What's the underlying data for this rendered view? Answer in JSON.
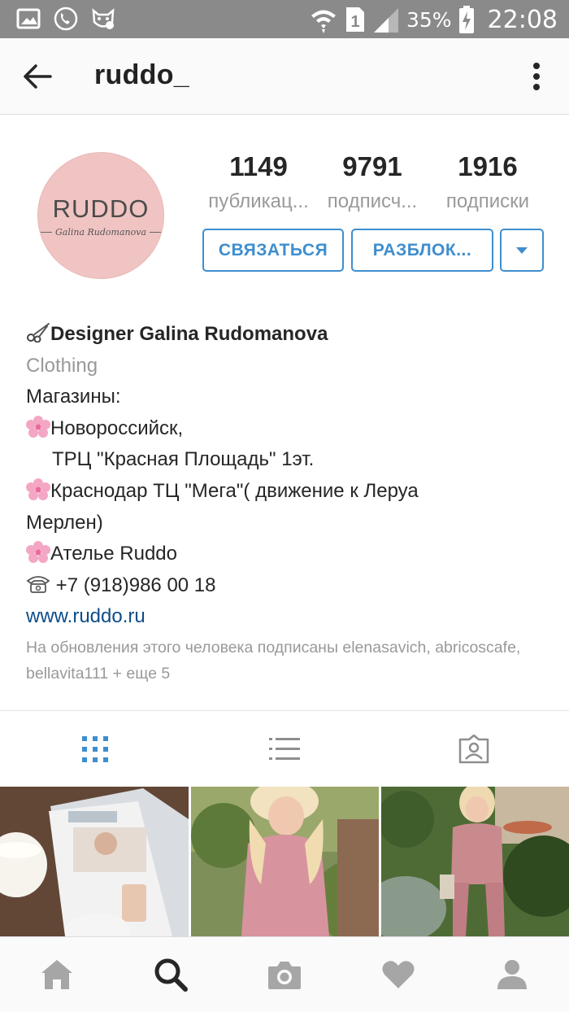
{
  "status_bar": {
    "battery": "35%",
    "time": "22:08",
    "sim_slot": "1",
    "icons": [
      "gallery-icon",
      "phone-sync-icon",
      "cat-app-icon",
      "wifi-icon",
      "sim-icon",
      "signal-icon",
      "battery-charging-icon"
    ]
  },
  "header": {
    "title": "ruddo_",
    "back_icon": "arrow-left-icon",
    "menu_icon": "more-vertical-icon"
  },
  "profile": {
    "avatar_brand": "RUDDO",
    "avatar_sub": "Galina Rudomanova",
    "stats": [
      {
        "value": "1149",
        "label": "публикац..."
      },
      {
        "value": "9791",
        "label": "подписч..."
      },
      {
        "value": "1916",
        "label": "подписки"
      }
    ],
    "buttons": {
      "contact": "СВЯЗАТЬСЯ",
      "unblock": "РАЗБЛОК...",
      "dropdown_icon": "caret-down-icon"
    }
  },
  "bio": {
    "name": "Designer Galina Rudomanova",
    "category": "Clothing",
    "lines": [
      "Магазины:",
      "Новороссийск,",
      "ТРЦ \"Красная  Площадь\" 1эт.",
      "Краснодар ТЦ \"Мега\"( движение к Леруа",
      "Мерлен)",
      "Ателье Ruddo",
      "+7 (918)986 00 18"
    ],
    "link": "www.ruddo.ru"
  },
  "followed_by": "На обновления этого человека подписаны elenasavich, abricoscafe, bellavita111 + еще 5",
  "tabs": [
    {
      "name": "grid",
      "icon": "grid-icon",
      "active": true
    },
    {
      "name": "list",
      "icon": "list-icon",
      "active": false
    },
    {
      "name": "tagged",
      "icon": "tagged-icon",
      "active": false
    }
  ],
  "posts": [
    {
      "name": "post-magazine"
    },
    {
      "name": "post-pink-outfit-1"
    },
    {
      "name": "post-pink-outfit-2"
    }
  ],
  "bottom_nav": [
    {
      "name": "home",
      "icon": "home-icon"
    },
    {
      "name": "search",
      "icon": "search-icon",
      "active": true
    },
    {
      "name": "camera",
      "icon": "camera-icon"
    },
    {
      "name": "activity",
      "icon": "heart-icon"
    },
    {
      "name": "profile",
      "icon": "profile-icon"
    }
  ],
  "colors": {
    "accent": "#3e8ece",
    "link": "#0d4d8a",
    "muted": "#999999",
    "avatar_bg": "#f0c4c2",
    "status_bar": "#8a8a8a"
  }
}
